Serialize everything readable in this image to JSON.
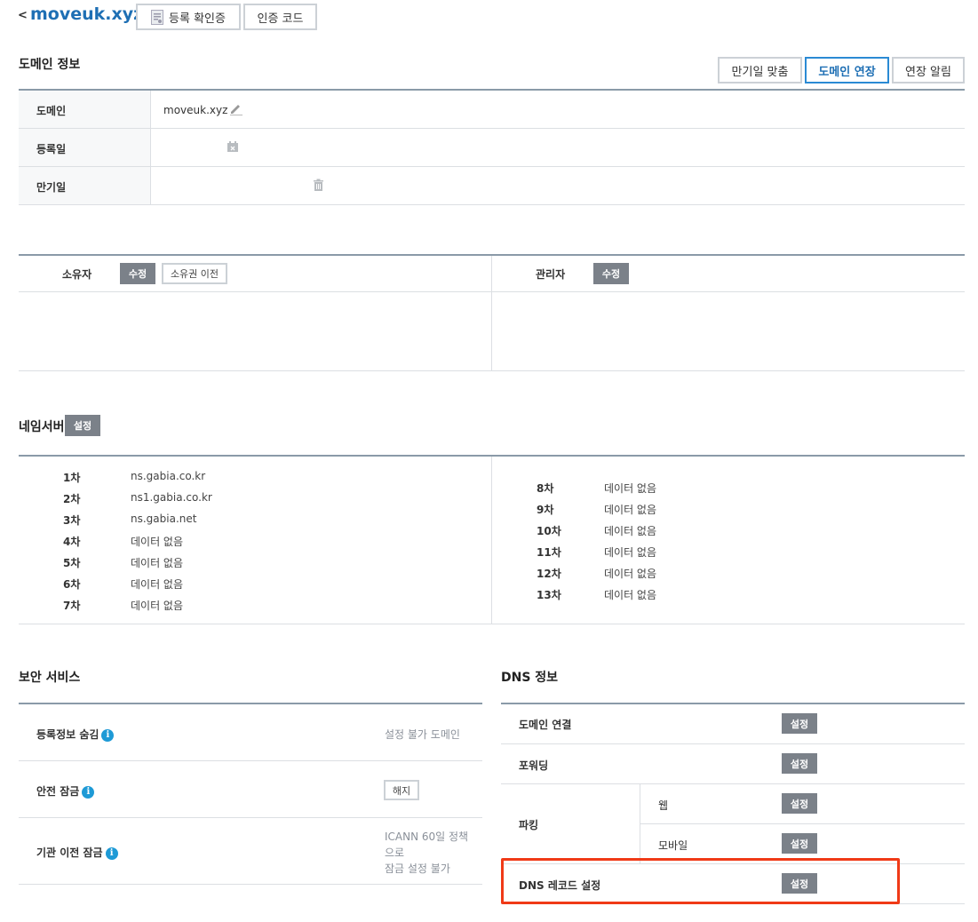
{
  "header": {
    "back": "<",
    "domain": "moveuk.xyz",
    "cert_button": "등록 확인증",
    "auth_code_button": "인증 코드"
  },
  "domain_info": {
    "title": "도메인 정보",
    "buttons": {
      "match_expiry": "만기일 맞춤",
      "renew": "도메인 연장",
      "renew_notice": "연장 알림"
    },
    "rows": {
      "domain_label": "도메인",
      "domain_value": "moveuk.xyz",
      "registered_label": "등록일",
      "expiry_label": "만기일"
    }
  },
  "contacts": {
    "owner_label": "소유자",
    "owner_edit": "수정",
    "owner_transfer": "소유권 이전",
    "admin_label": "관리자",
    "admin_edit": "수정"
  },
  "nameserver": {
    "title": "네임서버",
    "setup": "설정",
    "left": [
      {
        "rank": "1차",
        "value": "ns.gabia.co.kr"
      },
      {
        "rank": "2차",
        "value": "ns1.gabia.co.kr"
      },
      {
        "rank": "3차",
        "value": "ns.gabia.net"
      },
      {
        "rank": "4차",
        "value": "데이터 없음"
      },
      {
        "rank": "5차",
        "value": "데이터 없음"
      },
      {
        "rank": "6차",
        "value": "데이터 없음"
      },
      {
        "rank": "7차",
        "value": "데이터 없음"
      }
    ],
    "right": [
      {
        "rank": "8차",
        "value": "데이터 없음"
      },
      {
        "rank": "9차",
        "value": "데이터 없음"
      },
      {
        "rank": "10차",
        "value": "데이터 없음"
      },
      {
        "rank": "11차",
        "value": "데이터 없음"
      },
      {
        "rank": "12차",
        "value": "데이터 없음"
      },
      {
        "rank": "13차",
        "value": "데이터 없음"
      }
    ]
  },
  "security": {
    "title": "보안 서비스",
    "privacy_label": "등록정보 숨김",
    "privacy_value": "설정 불가 도메인",
    "safe_lock_label": "안전 잠금",
    "safe_lock_button": "해지",
    "transfer_lock_label": "기관 이전 잠금",
    "transfer_lock_value_1": "ICANN 60일 정책",
    "transfer_lock_value_2": "으로",
    "transfer_lock_value_3": "잠금 설정 불가",
    "info_glyph": "i"
  },
  "dns": {
    "title": "DNS 정보",
    "connect_label": "도메인 연결",
    "forwarding_label": "포워딩",
    "parking_label": "파킹",
    "web_label": "웹",
    "mobile_label": "모바일",
    "record_label": "DNS 레코드 설정",
    "setup": "설정",
    "highlight_color": "#f03a17"
  }
}
